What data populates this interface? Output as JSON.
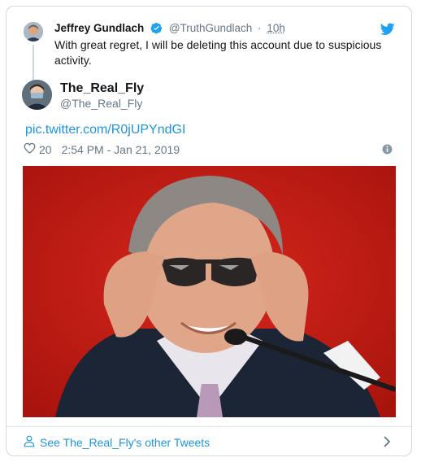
{
  "quoted": {
    "name": "Jeffrey Gundlach",
    "handle": "@TruthGundlach",
    "separator": "·",
    "time": "10h",
    "text": "With great regret, I will be deleting this account due to suspicious activity."
  },
  "author": {
    "name": "The_Real_Fly",
    "handle": "@The_Real_Fly"
  },
  "tweet": {
    "link": "pic.twitter.com/R0jUPYndGI",
    "likes": "20",
    "timestamp": "2:54 PM - Jan 21, 2019"
  },
  "footer": {
    "label": "See The_Real_Fly's other Tweets"
  },
  "colors": {
    "accent": "#1b95e0",
    "muted": "#657786",
    "photo_background": "#c81d14"
  },
  "icons": [
    "verified-badge-icon",
    "twitter-bird-icon",
    "heart-icon",
    "info-icon",
    "person-icon",
    "chevron-right-icon"
  ]
}
